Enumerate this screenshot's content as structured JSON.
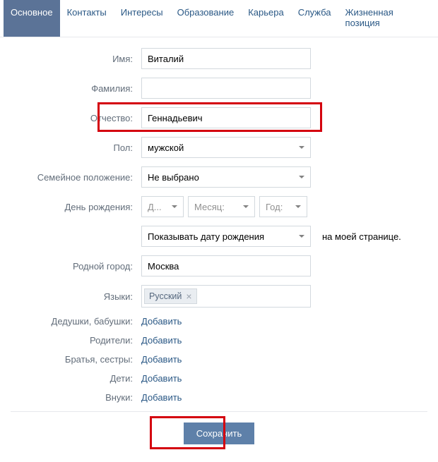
{
  "tabs": {
    "items": [
      "Основное",
      "Контакты",
      "Интересы",
      "Образование",
      "Карьера",
      "Служба",
      "Жизненная позиция"
    ],
    "active_index": 0
  },
  "labels": {
    "name": "Имя:",
    "surname": "Фамилия:",
    "patronymic": "Отчество:",
    "gender": "Пол:",
    "marital": "Семейное положение:",
    "birthday": "День рождения:",
    "hometown": "Родной город:",
    "languages": "Языки:",
    "grandparents": "Дедушки, бабушки:",
    "parents": "Родители:",
    "siblings": "Братья, сестры:",
    "children": "Дети:",
    "grandchildren": "Внуки:"
  },
  "values": {
    "name": "Виталий",
    "surname": "",
    "patronymic": "Геннадьевич",
    "gender": "мужской",
    "marital": "Не выбрано",
    "bday_day": "Д...",
    "bday_month": "Месяц:",
    "bday_year": "Год:",
    "show_bday": "Показывать дату рождения",
    "show_bday_after": "на моей странице.",
    "hometown": "Москва",
    "language_tag": "Русский"
  },
  "actions": {
    "add": "Добавить",
    "save": "Сохранить"
  }
}
